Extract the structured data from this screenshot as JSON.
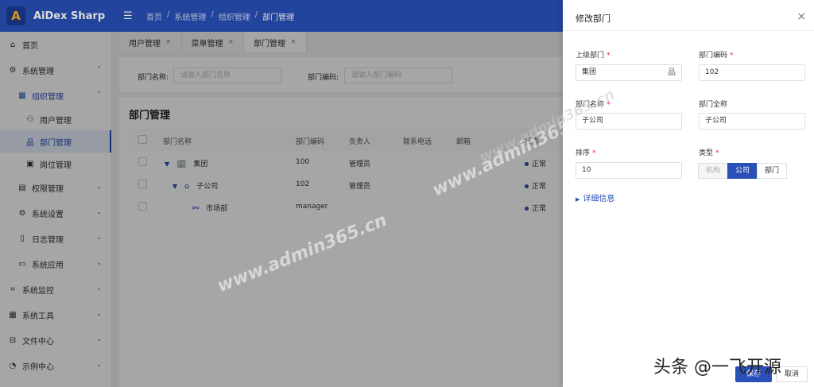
{
  "app": {
    "logo_letter": "A",
    "title": "AiDex Sharp"
  },
  "header": {
    "menu_toggle_icon": "menu-fold-icon",
    "breadcrumb": [
      "首页",
      "系统管理",
      "组织管理",
      "部门管理"
    ],
    "separator": "/"
  },
  "sidebar": {
    "items": [
      {
        "label": "首页",
        "icon": "⌂",
        "arrow": ""
      },
      {
        "label": "系统管理",
        "icon": "⚙",
        "arrow": "⌃"
      },
      {
        "label": "组织管理",
        "icon": "▦",
        "arrow": "⌃"
      },
      {
        "label": "用户管理",
        "icon": "⚇"
      },
      {
        "label": "部门管理",
        "icon": "品"
      },
      {
        "label": "岗位管理",
        "icon": "▣"
      },
      {
        "label": "权限管理",
        "icon": "▤",
        "arrow": "⌄"
      },
      {
        "label": "系统设置",
        "icon": "⚙",
        "arrow": "⌄"
      },
      {
        "label": "日志管理",
        "icon": "▯",
        "arrow": "⌄"
      },
      {
        "label": "系统应用",
        "icon": "▭",
        "arrow": "⌄"
      },
      {
        "label": "系统监控",
        "icon": "⌗",
        "arrow": "⌄"
      },
      {
        "label": "系统工具",
        "icon": "▦",
        "arrow": "⌄"
      },
      {
        "label": "文件中心",
        "icon": "⊟",
        "arrow": "⌄"
      },
      {
        "label": "示例中心",
        "icon": "◔",
        "arrow": "⌄"
      }
    ]
  },
  "tabs": [
    {
      "label": "用户管理",
      "close": "×"
    },
    {
      "label": "菜单管理",
      "close": "×"
    },
    {
      "label": "部门管理",
      "close": "×"
    }
  ],
  "search": {
    "dept_name_label": "部门名称:",
    "dept_name_placeholder": "请输入部门名称",
    "dept_code_label": "部门编码:",
    "dept_code_placeholder": "请输入部门编码"
  },
  "table": {
    "title": "部门管理",
    "columns": [
      "部门名称",
      "部门编码",
      "负责人",
      "联系电话",
      "邮箱",
      "状态"
    ],
    "rows": [
      {
        "arrow": "▼",
        "icon": "🏢",
        "name": "集团",
        "code": "100",
        "leader": "管理员",
        "status": "正常"
      },
      {
        "arrow": "▼",
        "icon": "⌂",
        "name": "子公司",
        "code": "102",
        "leader": "管理员",
        "status": "正常"
      },
      {
        "arrow": "",
        "icon": "⚯",
        "name": "市场部",
        "code": "manager",
        "leader": "",
        "status": "正常"
      }
    ]
  },
  "drawer": {
    "title": "修改部门",
    "close": "×",
    "required_mark": "*",
    "fields": {
      "parent_label": "上级部门",
      "parent_value": "集团",
      "code_label": "部门编码",
      "code_value": "102",
      "name_label": "部门名称",
      "name_value": "子公司",
      "fullname_label": "部门全称",
      "fullname_value": "子公司",
      "sort_label": "排序",
      "sort_value": "10",
      "type_label": "类型",
      "type_options": [
        "机构",
        "公司",
        "部门"
      ],
      "type_selected": "公司"
    },
    "more_info": "详细信息",
    "save_label": "保存",
    "cancel_label": "取消"
  },
  "watermarks": {
    "site": "www.admin365.cn",
    "corner": "头条 @一飞开源"
  }
}
